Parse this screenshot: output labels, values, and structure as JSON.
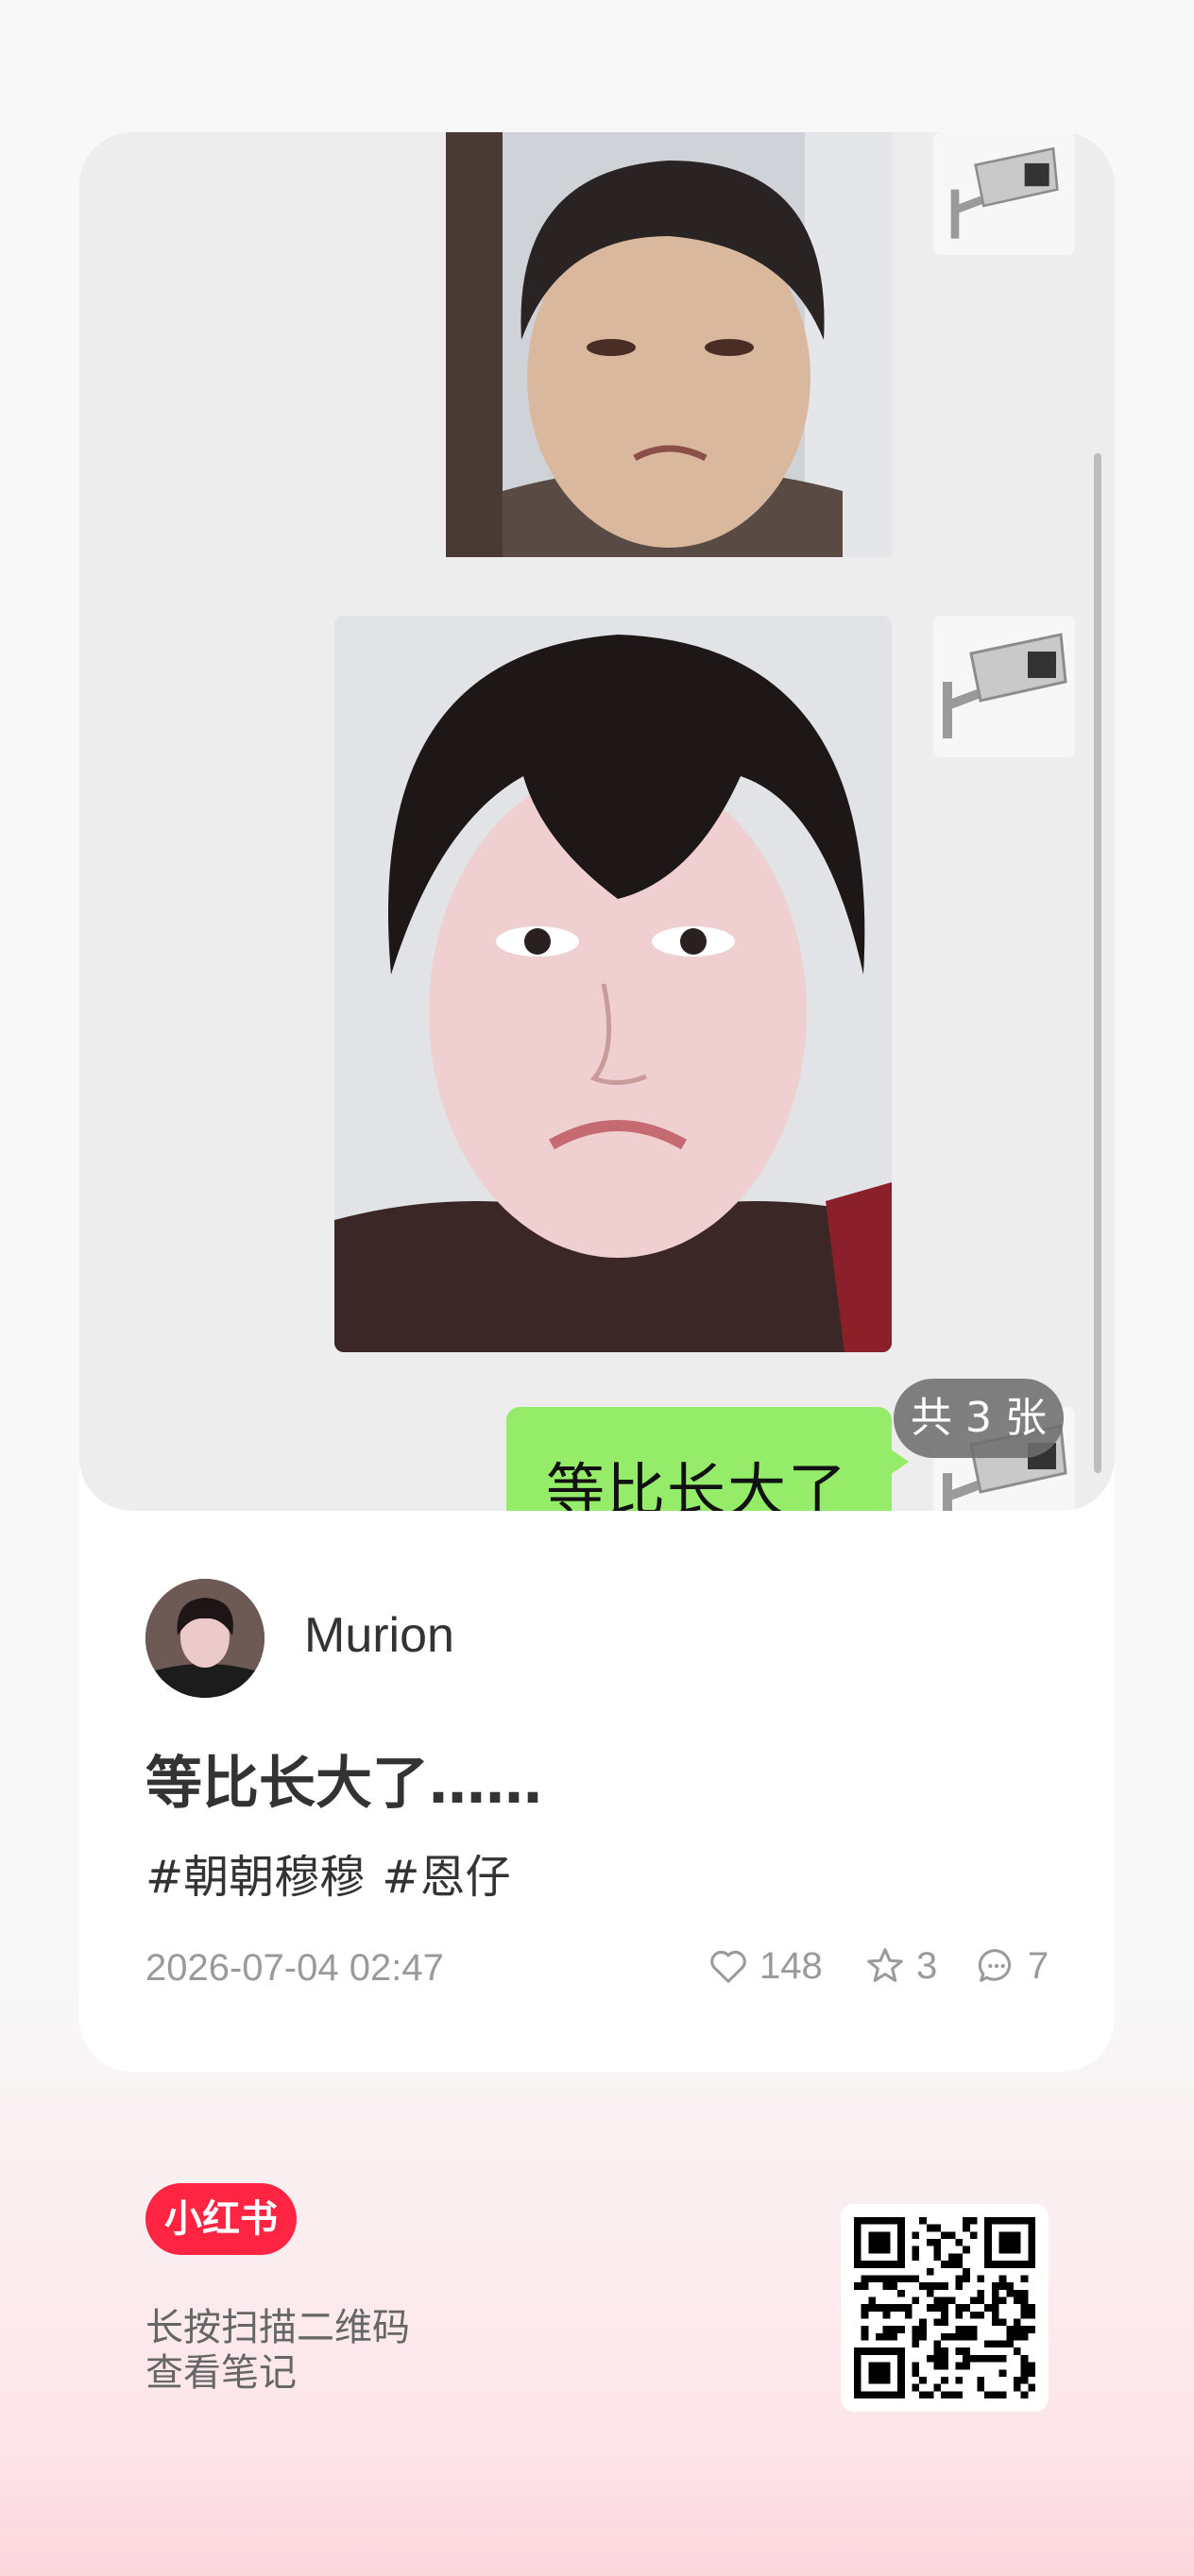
{
  "chat": {
    "message_text": "等比长大了",
    "image_count_badge": "共 3 张"
  },
  "author": {
    "name": "Murion"
  },
  "note": {
    "title": "等比长大了……",
    "tags": [
      "#朝朝穆穆",
      "#恩仔"
    ],
    "date": "2026-07-04 02:47",
    "likes": "148",
    "collects": "3",
    "comments": "7"
  },
  "footer": {
    "brand": "小红书",
    "hint_line1": "长按扫描二维码",
    "hint_line2": "查看笔记"
  },
  "colors": {
    "brand_red": "#ff2442",
    "bubble_green": "#95ec69",
    "chat_bg": "#ededed"
  },
  "icons": [
    "security-camera-icon",
    "heart-icon",
    "star-icon",
    "comment-icon",
    "qr-code"
  ]
}
